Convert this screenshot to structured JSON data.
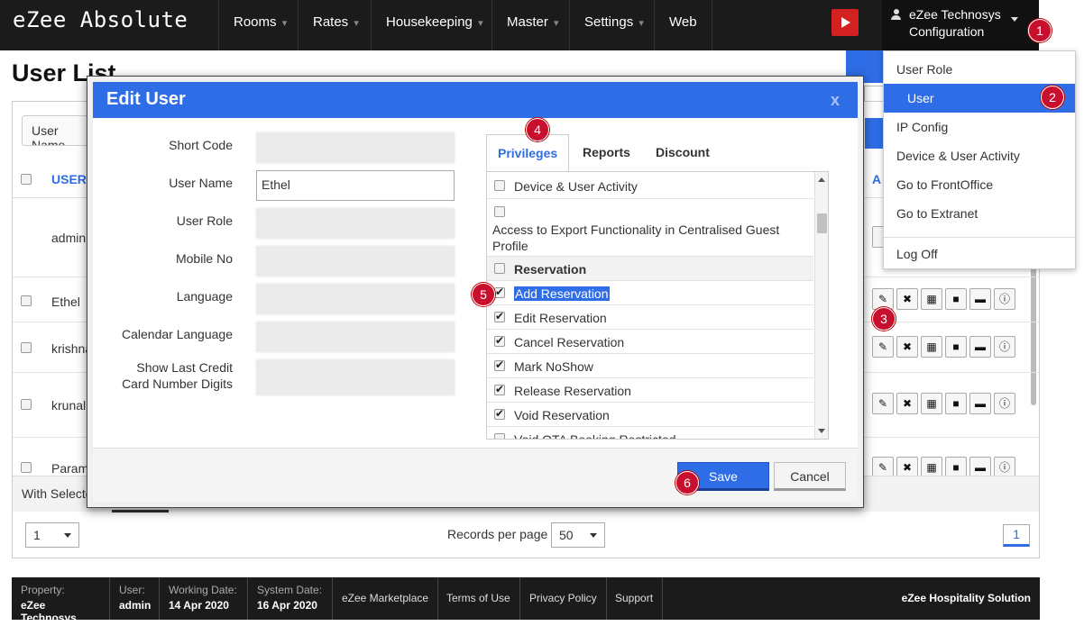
{
  "app": {
    "title": "eZee Absolute"
  },
  "nav": {
    "items": [
      {
        "label": "Rooms",
        "has_menu": true
      },
      {
        "label": "Rates",
        "has_menu": true
      },
      {
        "label": "Housekeeping",
        "has_menu": true
      },
      {
        "label": "Master",
        "has_menu": true
      },
      {
        "label": "Settings",
        "has_menu": true
      },
      {
        "label": "Web",
        "has_menu": false
      }
    ],
    "youtube_icon": "youtube-icon",
    "user_line1": "eZee Technosys",
    "user_line2": "Configuration"
  },
  "user_menu": {
    "items": [
      "User Role",
      "User",
      "IP Config",
      "Device & User Activity",
      "Go to FrontOffice",
      "Go to Extranet",
      "Log Off"
    ],
    "active": "User"
  },
  "badges": [
    "1",
    "2",
    "3",
    "4",
    "5",
    "6"
  ],
  "page": {
    "title": "User List",
    "filter_label": "User Name",
    "header_user": "USER",
    "header_actions": "A",
    "rows": [
      "admin",
      "Ethel",
      "krishna",
      "krunal",
      "Param"
    ],
    "with_selected": "With Selected",
    "page_select": "1",
    "records_per_page_label": "Records per page",
    "records_per_page": "50",
    "current_page": "1"
  },
  "footer": {
    "property_label": "Property:",
    "property": "eZee Technosys",
    "user_label": "User:",
    "user": "admin",
    "working_date_label": "Working Date:",
    "working_date": "14 Apr 2020",
    "system_date_label": "System Date:",
    "system_date": "16 Apr 2020",
    "links": [
      "eZee Marketplace",
      "Terms of Use",
      "Privacy Policy",
      "Support"
    ],
    "brand": "eZee Hospitality Solution"
  },
  "modal": {
    "title": "Edit User",
    "close": "x",
    "fields": {
      "short_code_label": "Short Code",
      "user_name_label": "User Name",
      "user_name_value": "Ethel",
      "user_role_label": "User Role",
      "mobile_label": "Mobile No",
      "language_label": "Language",
      "calendar_language_label": "Calendar Language",
      "last_digits_label_1": "Show Last Credit",
      "last_digits_label_2": "Card Number Digits"
    },
    "tabs": [
      "Privileges",
      "Reports",
      "Discount"
    ],
    "active_tab": "Privileges",
    "privileges": [
      {
        "label": "Device & User Activity",
        "checked": false
      },
      {
        "label": "Access to Export Functionality in Centralised Guest Profile",
        "checked": false
      },
      {
        "label": "Reservation",
        "checked": false,
        "header": true
      },
      {
        "label": "Add Reservation",
        "checked": true,
        "selected": true
      },
      {
        "label": "Edit Reservation",
        "checked": true
      },
      {
        "label": "Cancel Reservation",
        "checked": true
      },
      {
        "label": "Mark NoShow",
        "checked": true
      },
      {
        "label": "Release Reservation",
        "checked": true
      },
      {
        "label": "Void Reservation",
        "checked": true
      },
      {
        "label": "Void OTA Booking Restricted",
        "checked": false
      }
    ],
    "save": "Save",
    "cancel": "Cancel"
  },
  "colors": {
    "accent": "#2e6de5",
    "nav_bg": "#1b1b1b",
    "badge": "#c8102e"
  }
}
